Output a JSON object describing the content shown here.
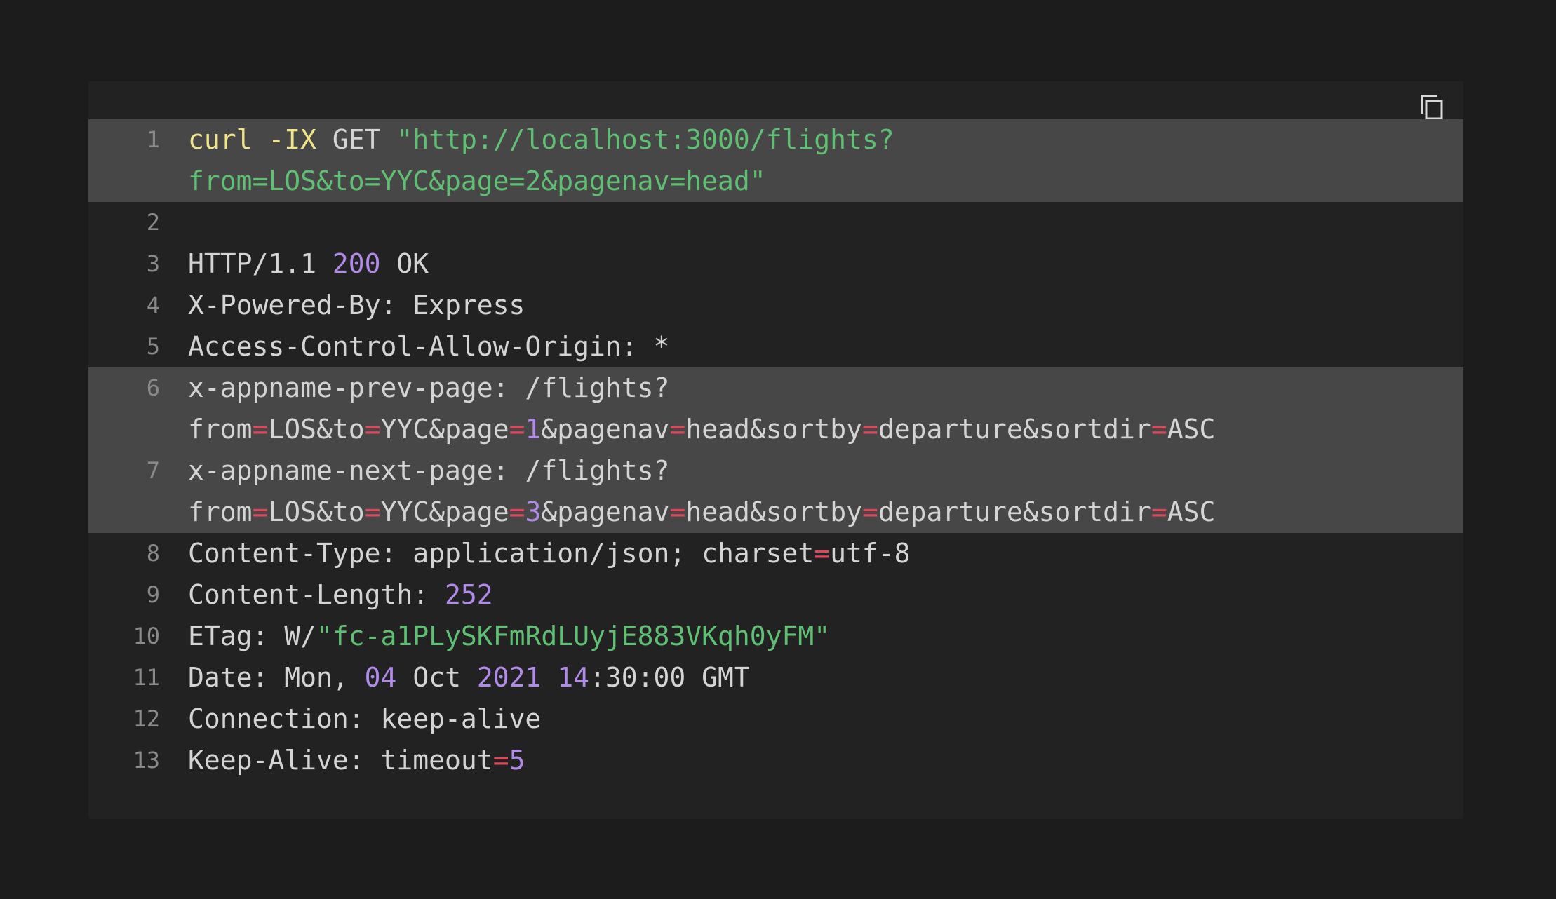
{
  "copy_icon": "copy-icon",
  "colors": {
    "background": "#1c1c1c",
    "panel": "#222222",
    "highlight": "#474747",
    "text": "#d4d4d4",
    "line_number": "#8a8a8a",
    "command": "#f0e48a",
    "string": "#5fbf73",
    "number": "#b08be8",
    "operator": "#e0475a"
  },
  "lines": {
    "l1": {
      "num": "1",
      "cmd": "curl",
      "sp1": " ",
      "flag": "-IX",
      "sp2": " GET ",
      "url_a": "\"http://localhost:3000/flights?"
    },
    "l1b": {
      "url_b": "from=LOS&to=YYC&page=2&pagenav=head\""
    },
    "l2": {
      "num": "2"
    },
    "l3": {
      "num": "3",
      "a": "HTTP/1.1 ",
      "code": "200",
      "b": " OK"
    },
    "l4": {
      "num": "4",
      "text": "X-Powered-By: Express"
    },
    "l5": {
      "num": "5",
      "text": "Access-Control-Allow-Origin: *"
    },
    "l6": {
      "num": "6",
      "a": "x-appname-prev-page: /flights?"
    },
    "l6b": {
      "from": "from",
      "eq": "=",
      "los": "LOS&to",
      "yyc": "YYC&page",
      "page": "1",
      "pagenav": "&pagenav",
      "head": "head&sortby",
      "dep": "departure&sortdir",
      "asc": "ASC"
    },
    "l7": {
      "num": "7",
      "a": "x-appname-next-page: /flights?"
    },
    "l7b": {
      "from": "from",
      "eq": "=",
      "los": "LOS&to",
      "yyc": "YYC&page",
      "page": "3",
      "pagenav": "&pagenav",
      "head": "head&sortby",
      "dep": "departure&sortdir",
      "asc": "ASC"
    },
    "l8": {
      "num": "8",
      "a": "Content-Type: application/json; charset",
      "eq": "=",
      "b": "utf-8"
    },
    "l9": {
      "num": "9",
      "a": "Content-Length: ",
      "n": "252"
    },
    "l10": {
      "num": "10",
      "a": "ETag: W/",
      "s": "\"fc-a1PLySKFmRdLUyjE883VKqh0yFM\""
    },
    "l11": {
      "num": "11",
      "a": "Date: Mon, ",
      "d": "04",
      "b": " Oct ",
      "y": "2021",
      "sp": " ",
      "h": "14",
      "c": ":30:00 GMT"
    },
    "l12": {
      "num": "12",
      "text": "Connection: keep-alive"
    },
    "l13": {
      "num": "13",
      "a": "Keep-Alive: timeout",
      "eq": "=",
      "n": "5"
    }
  }
}
